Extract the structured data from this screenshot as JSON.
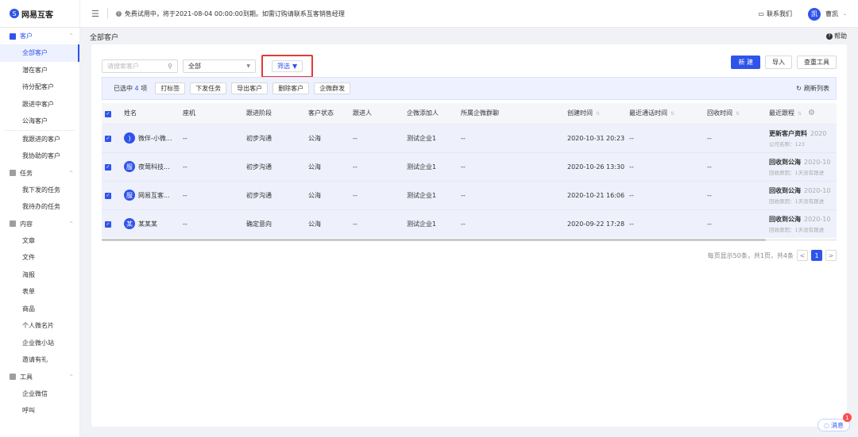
{
  "topbar": {
    "logo_mark": "S",
    "app_name": "网易互客",
    "notice": "免费试用中，将于2021-08-04 00:00:00到期。如需订购请联系互客销售经理",
    "contact": "联系我们",
    "user_avatar": "凯",
    "user_name": "曹凯"
  },
  "sidebar": {
    "sections": [
      {
        "label": "客户",
        "items": [
          "全部客户",
          "潜在客户",
          "待分配客户",
          "跟进中客户",
          "公海客户"
        ],
        "extra": [
          "我跟进的客户",
          "我协助的客户"
        ]
      },
      {
        "label": "任务",
        "items": [
          "我下发的任务",
          "我待办的任务"
        ]
      },
      {
        "label": "内容",
        "items": [
          "文章",
          "文件",
          "海报",
          "表单",
          "商品",
          "个人微名片",
          "企业微小站",
          "邀请有礼"
        ]
      },
      {
        "label": "工具",
        "items": [
          "企业微信",
          "呼叫"
        ]
      }
    ]
  },
  "breadcrumb": "全部客户",
  "help": "帮助",
  "filters": {
    "search_placeholder": "请搜索客户",
    "select_value": "全部",
    "filter_label": "筛选"
  },
  "actions": {
    "new": "新 建",
    "import": "导入",
    "dedupe": "查重工具"
  },
  "bulk": {
    "selected_prefix": "已选中",
    "selected_count": "4",
    "selected_suffix": "项",
    "buttons": [
      "打标签",
      "下发任务",
      "导出客户",
      "删除客户",
      "企微群发"
    ],
    "refresh": "刷新列表"
  },
  "table": {
    "columns": [
      "姓名",
      "座机",
      "跟进阶段",
      "客户状态",
      "跟进人",
      "企微添加人",
      "所属企微群聊",
      "创建时间",
      "最近通话时间",
      "回收时间",
      "最近跟程"
    ],
    "rows": [
      {
        "avatar": ")",
        "name": "微伴-小微...",
        "phone": "--",
        "stage": "初步沟通",
        "status": "公海",
        "owner": "--",
        "adder": "测试企业1",
        "group": "--",
        "created": "2020-10-31 20:23",
        "last_call": "--",
        "recycle": "--",
        "recent_title": "更新客户资料",
        "recent_date": "2020",
        "recent_sub": "公司名称：123"
      },
      {
        "avatar": "服",
        "name": "夜莺科技...",
        "phone": "--",
        "stage": "初步沟通",
        "status": "公海",
        "owner": "--",
        "adder": "测试企业1",
        "group": "--",
        "created": "2020-10-26 13:30",
        "last_call": "--",
        "recycle": "--",
        "recent_title": "回收到公海",
        "recent_date": "2020-10",
        "recent_sub": "回收原因：1天没有跟进"
      },
      {
        "avatar": "服",
        "name": "网易互客...",
        "phone": "--",
        "stage": "初步沟通",
        "status": "公海",
        "owner": "--",
        "adder": "测试企业1",
        "group": "--",
        "created": "2020-10-21 16:06",
        "last_call": "--",
        "recycle": "--",
        "recent_title": "回收到公海",
        "recent_date": "2020-10",
        "recent_sub": "回收原因：1天没有跟进"
      },
      {
        "avatar": "某",
        "name": "某某某",
        "phone": "--",
        "stage": "确定意向",
        "status": "公海",
        "owner": "--",
        "adder": "测试企业1",
        "group": "--",
        "created": "2020-09-22 17:28",
        "last_call": "--",
        "recycle": "--",
        "recent_title": "回收到公海",
        "recent_date": "2020-10",
        "recent_sub": "回收原因：1天没有跟进"
      }
    ]
  },
  "pager": {
    "summary": "每页显示50条，共1页，共4条",
    "current": "1",
    "prev": "<",
    "next": ">"
  },
  "message": {
    "label": "消息",
    "badge": "1"
  }
}
